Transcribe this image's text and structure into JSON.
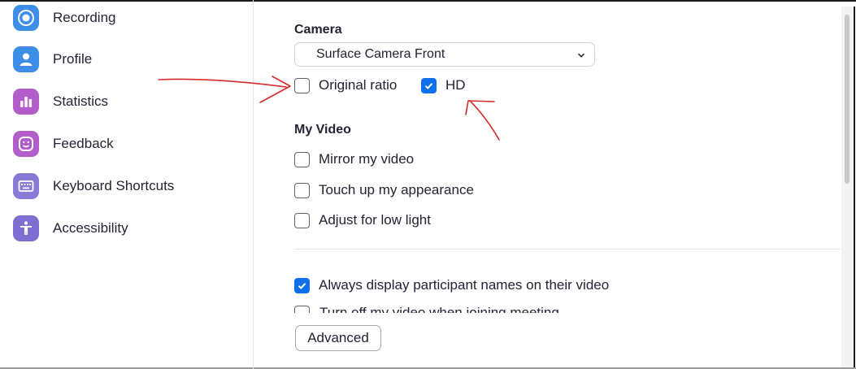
{
  "sidebar": {
    "items": [
      {
        "label": "Recording",
        "icon": "recording-icon",
        "color": "#2d8cff"
      },
      {
        "label": "Profile",
        "icon": "profile-icon",
        "color": "#2d8cff"
      },
      {
        "label": "Statistics",
        "icon": "statistics-icon",
        "color": "#a053cc"
      },
      {
        "label": "Feedback",
        "icon": "feedback-icon",
        "color": "#a053cc"
      },
      {
        "label": "Keyboard Shortcuts",
        "icon": "keyboard-icon",
        "color": "#7f6ed1"
      },
      {
        "label": "Accessibility",
        "icon": "accessibility-icon",
        "color": "#7f6ed1"
      }
    ]
  },
  "camera": {
    "title": "Camera",
    "selected_device": "Surface Camera Front",
    "original_ratio": {
      "label": "Original ratio",
      "checked": false
    },
    "hd": {
      "label": "HD",
      "checked": true
    }
  },
  "my_video": {
    "title": "My Video",
    "mirror": {
      "label": "Mirror my video",
      "checked": false
    },
    "touch_up": {
      "label": "Touch up my appearance",
      "checked": false
    },
    "low_light": {
      "label": "Adjust for low light",
      "checked": false
    }
  },
  "more_options": {
    "display_names": {
      "label": "Always display participant names on their video",
      "checked": true
    },
    "cut_off_option": {
      "label": "Turn off my video when joining meeting",
      "checked": false
    }
  },
  "advanced_button": "Advanced",
  "colors": {
    "accent": "#0e71eb",
    "annotation": "#d42a2a"
  }
}
